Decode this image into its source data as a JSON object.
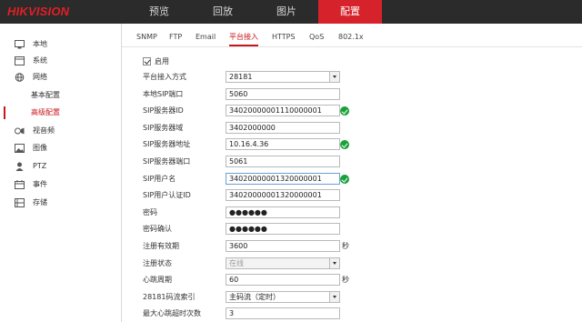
{
  "header": {
    "logo": "HIKVISION",
    "nav": [
      "预览",
      "回放",
      "图片",
      "配置"
    ]
  },
  "sidebar": {
    "items": [
      {
        "label": "本地",
        "icon": "monitor-icon"
      },
      {
        "label": "系统",
        "icon": "system-icon"
      },
      {
        "label": "网络",
        "icon": "globe-icon"
      },
      {
        "label": "视音频",
        "icon": "audio-video-icon"
      },
      {
        "label": "图像",
        "icon": "image-icon"
      },
      {
        "label": "PTZ",
        "icon": "ptz-icon"
      },
      {
        "label": "事件",
        "icon": "calendar-icon"
      },
      {
        "label": "存储",
        "icon": "storage-icon"
      }
    ],
    "sub": [
      "基本配置",
      "高级配置"
    ]
  },
  "tabs": [
    "SNMP",
    "FTP",
    "Email",
    "平台接入",
    "HTTPS",
    "QoS",
    "802.1x"
  ],
  "form": {
    "enable_label": "启用",
    "rows": [
      {
        "label": "平台接入方式",
        "value": "28181",
        "type": "select"
      },
      {
        "label": "本地SIP端口",
        "value": "5060"
      },
      {
        "label": "SIP服务器ID",
        "value": "34020000001110000001",
        "ok": true
      },
      {
        "label": "SIP服务器域",
        "value": "3402000000"
      },
      {
        "label": "SIP服务器地址",
        "value": "10.16.4.36",
        "ok": true
      },
      {
        "label": "SIP服务器端口",
        "value": "5061"
      },
      {
        "label": "SIP用户名",
        "value": "34020000001320000001",
        "ok": true,
        "focused": true
      },
      {
        "label": "SIP用户认证ID",
        "value": "34020000001320000001"
      },
      {
        "label": "密码",
        "value": "●●●●●●"
      },
      {
        "label": "密码确认",
        "value": "●●●●●●"
      },
      {
        "label": "注册有效期",
        "value": "3600",
        "unit": "秒"
      },
      {
        "label": "注册状态",
        "value": "在线",
        "type": "select",
        "disabled": true
      },
      {
        "label": "心跳周期",
        "value": "60",
        "unit": "秒"
      },
      {
        "label": "28181码流索引",
        "value": "主码流（定时）",
        "type": "select"
      },
      {
        "label": "最大心跳超时次数",
        "value": "3"
      }
    ]
  }
}
